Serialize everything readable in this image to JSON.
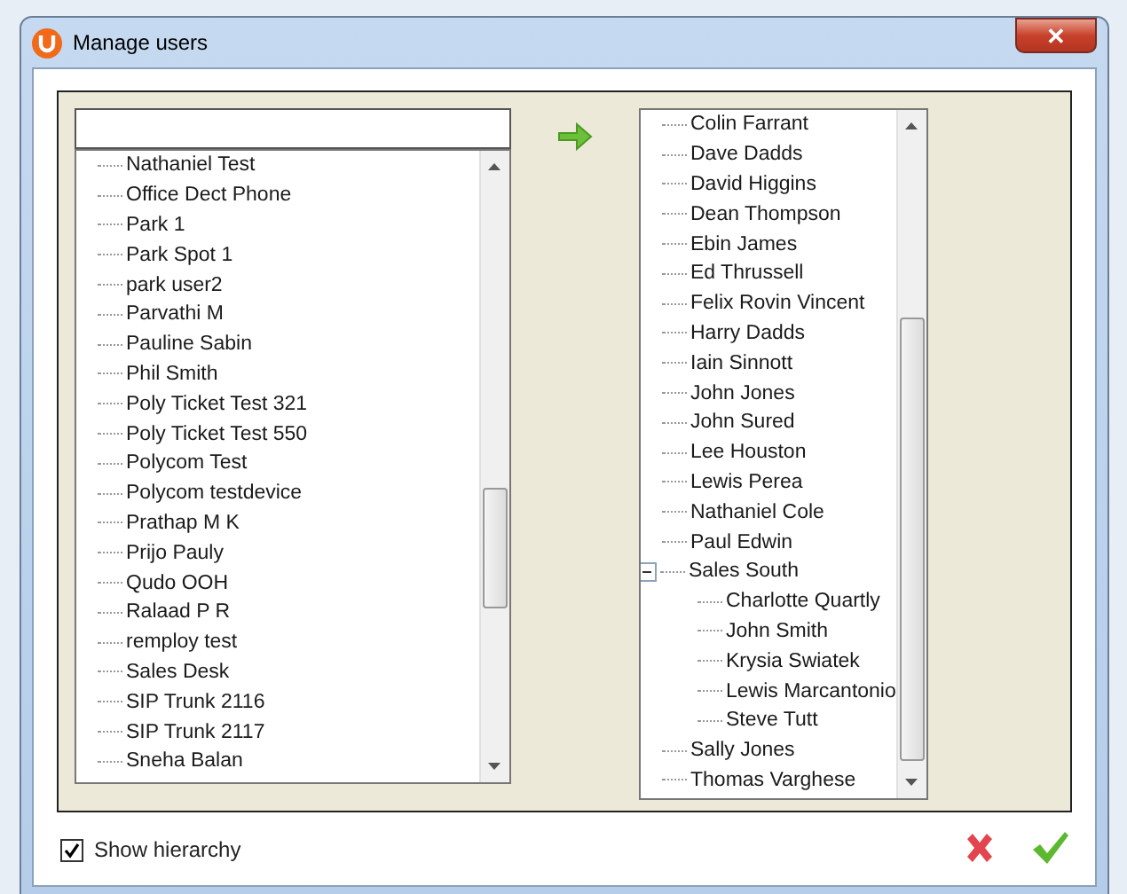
{
  "window": {
    "title": "Manage users",
    "close_label": "✕"
  },
  "available_users": [
    {
      "label": "Nathaniel Test"
    },
    {
      "label": "Office Dect Phone"
    },
    {
      "label": "Park 1"
    },
    {
      "label": "Park Spot 1"
    },
    {
      "label": "park user2"
    },
    {
      "label": "Parvathi M"
    },
    {
      "label": "Pauline Sabin"
    },
    {
      "label": "Phil Smith"
    },
    {
      "label": "Poly Ticket Test 321"
    },
    {
      "label": "Poly Ticket Test 550"
    },
    {
      "label": "Polycom Test"
    },
    {
      "label": "Polycom testdevice"
    },
    {
      "label": "Prathap M K"
    },
    {
      "label": "Prijo Pauly"
    },
    {
      "label": "Qudo OOH"
    },
    {
      "label": "Ralaad P R"
    },
    {
      "label": "remploy test"
    },
    {
      "label": "Sales Desk"
    },
    {
      "label": "SIP Trunk 2116"
    },
    {
      "label": "SIP Trunk 2117"
    },
    {
      "label": "Sneha Balan"
    }
  ],
  "assigned_users": [
    {
      "label": "Colin Farrant"
    },
    {
      "label": "Dave Dadds"
    },
    {
      "label": "David Higgins"
    },
    {
      "label": "Dean Thompson"
    },
    {
      "label": "Ebin James"
    },
    {
      "label": "Ed Thrussell"
    },
    {
      "label": "Felix Rovin Vincent"
    },
    {
      "label": "Harry Dadds"
    },
    {
      "label": "Iain Sinnott"
    },
    {
      "label": "John Jones"
    },
    {
      "label": "John Sured"
    },
    {
      "label": "Lee Houston"
    },
    {
      "label": "Lewis Perea"
    },
    {
      "label": "Nathaniel Cole"
    },
    {
      "label": "Paul Edwin"
    },
    {
      "label": "Sales South",
      "expanded": true,
      "children": [
        {
          "label": "Charlotte Quartly"
        },
        {
          "label": "John Smith"
        },
        {
          "label": "Krysia Swiatek"
        },
        {
          "label": "Lewis Marcantonio"
        },
        {
          "label": "Steve Tutt"
        }
      ]
    },
    {
      "label": "Sally Jones"
    },
    {
      "label": "Thomas Varghese"
    }
  ],
  "show_hierarchy": {
    "label": "Show hierarchy",
    "checked": true
  }
}
